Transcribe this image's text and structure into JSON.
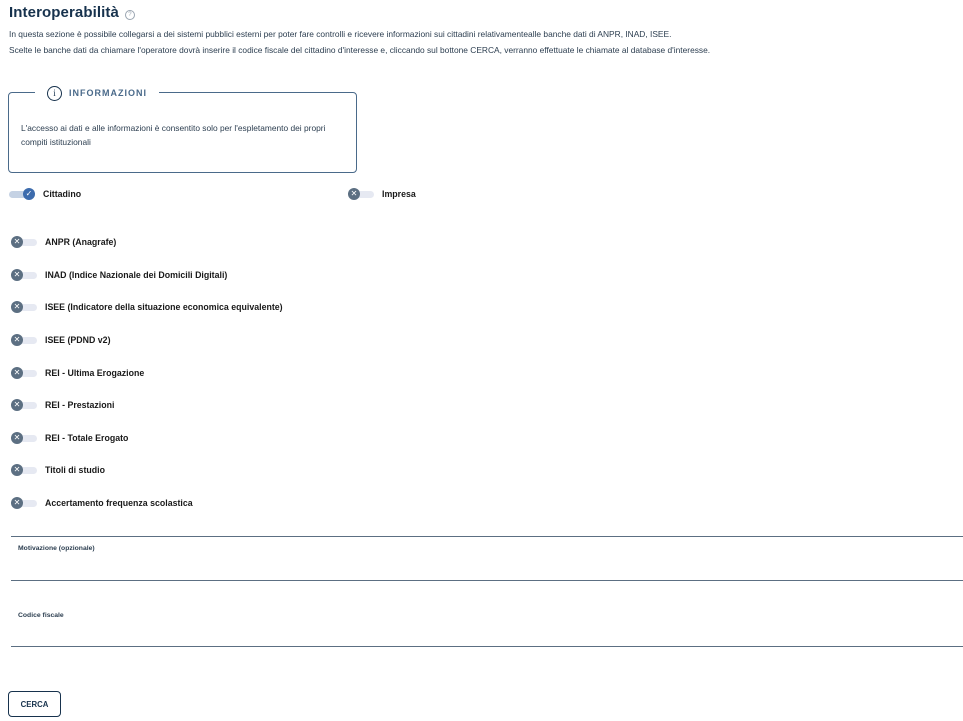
{
  "header": {
    "title": "Interoperabilità",
    "help_icon": "help-icon",
    "description_line1": "In questa sezione è possibile collegarsi a dei sistemi pubblici esterni per poter fare controlli e ricevere informazioni sui cittadini relativamenteal​le banche dati di ANPR, INAD, ISEE.",
    "description_line2": "Scelte le banche dati da chiamare l'operatore dovrà inserire il codice fiscale del cittadino d'interesse e, cliccando sul bottone CERCA, verranno effettuate le chiamate al database d'interesse."
  },
  "info_box": {
    "icon": "info-icon",
    "title": "INFORMAZIONI",
    "text": "L'accesso ai dati e alle informazioni è consentito solo per l'espletamento dei propri compiti istituzionali"
  },
  "subject_toggles": [
    {
      "label": "Cittadino",
      "checked": true
    },
    {
      "label": "Impresa",
      "checked": false
    }
  ],
  "database_toggles": [
    {
      "label": "ANPR (Anagrafe)",
      "checked": false
    },
    {
      "label": "INAD (Indice Nazionale dei Domicili Digitali)",
      "checked": false
    },
    {
      "label": "ISEE (Indicatore della situazione economica equivalente)",
      "checked": false
    },
    {
      "label": "ISEE (PDND v2)",
      "checked": false
    },
    {
      "label": "REI - Ultima Erogazione",
      "checked": false
    },
    {
      "label": "REI - Prestazioni",
      "checked": false
    },
    {
      "label": "REI - Totale Erogato",
      "checked": false
    },
    {
      "label": "Titoli di studio",
      "checked": false
    },
    {
      "label": "Accertamento frequenza scolastica",
      "checked": false
    }
  ],
  "fields": {
    "motivazione": {
      "label": "Motivazione (opzionale)",
      "value": ""
    },
    "codice_fiscale": {
      "label": "Codice fiscale",
      "value": ""
    }
  },
  "actions": {
    "search_label": "CERCA"
  },
  "colors": {
    "primary": "#17324d",
    "toggle_on": "#3d6cad",
    "toggle_off": "#5c6f82"
  }
}
